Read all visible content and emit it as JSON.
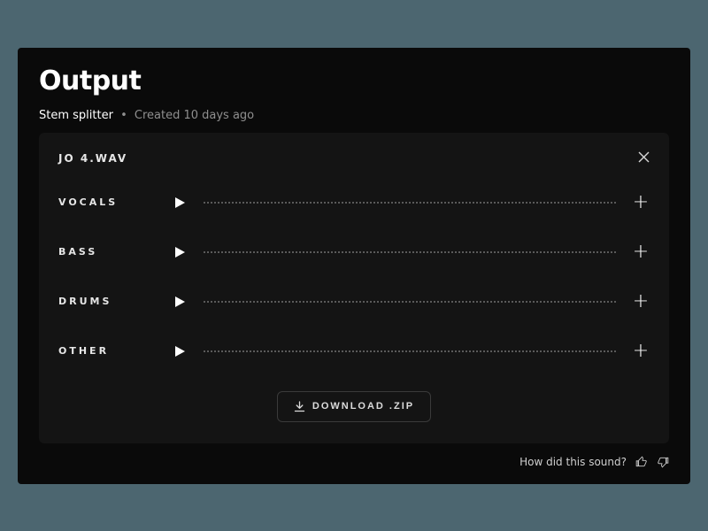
{
  "header": {
    "title": "Output",
    "source": "Stem splitter",
    "sep": "•",
    "created": "Created 10 days ago"
  },
  "file": {
    "name": "JO 4.WAV"
  },
  "stems": [
    {
      "label": "VOCALS"
    },
    {
      "label": "BASS"
    },
    {
      "label": "DRUMS"
    },
    {
      "label": "OTHER"
    }
  ],
  "download": {
    "label": "DOWNLOAD .ZIP"
  },
  "feedback": {
    "prompt": "How did this sound?"
  }
}
